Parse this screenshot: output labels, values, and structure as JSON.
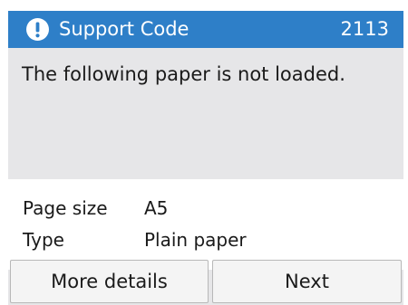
{
  "header": {
    "icon": "exclamation-icon",
    "title": "Support Code",
    "code": "2113",
    "color": "#2e7fc8"
  },
  "message": "The following paper is not loaded.",
  "details": [
    {
      "label": "Page size",
      "value": "A5"
    },
    {
      "label": "Type",
      "value": "Plain paper"
    }
  ],
  "buttons": {
    "more_details": "More details",
    "next": "Next"
  }
}
